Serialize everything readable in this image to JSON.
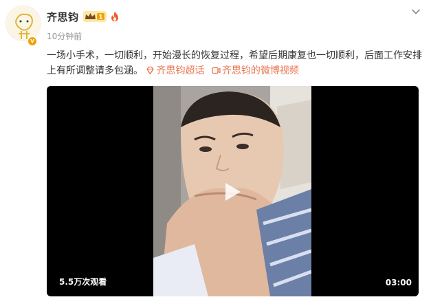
{
  "post": {
    "username": "齐思钧",
    "timestamp": "10分钟前",
    "badge_level": "1",
    "verified_mark": "v",
    "text_main": "一场小手术，一切顺利，开始漫长的恢复过程，希望后期康复也一切顺利，后面工作安排上有所调整请多包涵。",
    "supertopic_link": "齐思钧超话",
    "video_link": "齐思钧的微博视频"
  },
  "video": {
    "views": "5.5万次观看",
    "duration": "03:00",
    "play_state": "paused"
  },
  "icons": {
    "crown_badge": "crown-vip-badge-icon",
    "flame": "flame-icon",
    "diamond": "supertopic-diamond-icon",
    "video": "video-link-icon",
    "chevron": "chevron-down-icon",
    "play": "play-icon"
  },
  "colors": {
    "link": "#eb7350",
    "badge_gold": "#f2a100",
    "video_bg": "#000000"
  }
}
